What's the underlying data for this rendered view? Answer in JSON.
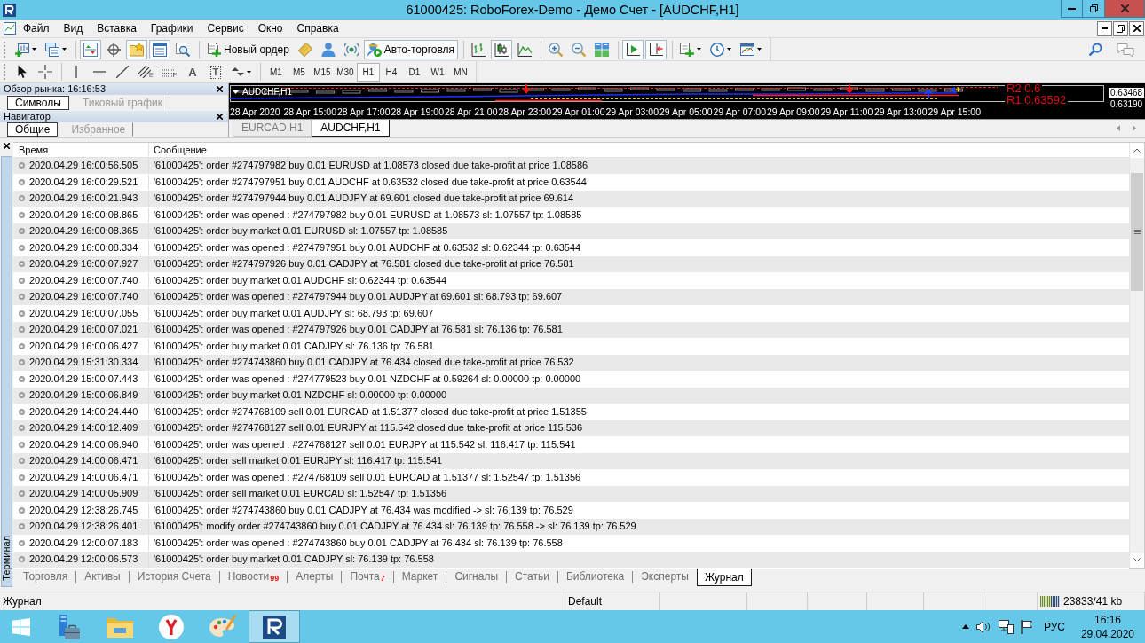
{
  "window": {
    "title": "61000425: RoboForex-Demo - Демо Счет - [AUDCHF,H1]"
  },
  "menu": [
    "Файл",
    "Вид",
    "Вставка",
    "Графики",
    "Сервис",
    "Окно",
    "Справка"
  ],
  "toolbar": {
    "groups": [
      [
        {
          "kind": "chart",
          "pressed": false
        },
        {
          "kind": "profiles",
          "pressed": false
        }
      ],
      [
        {
          "kind": "market",
          "pressed": true
        },
        {
          "kind": "navigator",
          "pressed": false
        },
        {
          "kind": "favorites",
          "pressed": true
        },
        {
          "kind": "data",
          "pressed": true
        },
        {
          "kind": "tester",
          "pressed": false
        }
      ],
      [
        {
          "kind": "order",
          "label": "Новый ордер",
          "pressed": false
        },
        {
          "kind": "editor",
          "pressed": false
        },
        {
          "kind": "vps",
          "pressed": false
        },
        {
          "kind": "signals",
          "pressed": false
        },
        {
          "kind": "autotrading",
          "label": "Авто-торговля",
          "pressed": true
        }
      ],
      [
        {
          "kind": "bars",
          "pressed": false
        },
        {
          "kind": "candles",
          "pressed": true
        },
        {
          "kind": "line",
          "pressed": false
        }
      ],
      [
        {
          "kind": "zoomin",
          "pressed": false
        },
        {
          "kind": "zoomout",
          "pressed": false
        },
        {
          "kind": "tile",
          "pressed": false
        }
      ],
      [
        {
          "kind": "autoscroll",
          "pressed": true
        },
        {
          "kind": "shift",
          "pressed": true
        }
      ],
      [
        {
          "kind": "indicators",
          "pressed": false
        },
        {
          "kind": "periods",
          "pressed": false
        },
        {
          "kind": "templates",
          "pressed": false
        }
      ]
    ]
  },
  "drawing_tools": [
    [
      {
        "kind": "cursor"
      },
      {
        "kind": "crosshair"
      }
    ],
    [
      {
        "kind": "vline"
      },
      {
        "kind": "hline"
      },
      {
        "kind": "trend"
      },
      {
        "kind": "channel",
        "glyph": "E"
      },
      {
        "kind": "fibo",
        "glyph": "F"
      },
      {
        "kind": "text",
        "glyph": "A"
      },
      {
        "kind": "label",
        "glyph": "T"
      },
      {
        "kind": "arrows"
      }
    ]
  ],
  "timeframes": [
    {
      "label": "M1",
      "selected": false
    },
    {
      "label": "M5",
      "selected": false
    },
    {
      "label": "M15",
      "selected": false
    },
    {
      "label": "M30",
      "selected": false
    },
    {
      "label": "H1",
      "selected": true
    },
    {
      "label": "H4",
      "selected": false
    },
    {
      "label": "D1",
      "selected": false
    },
    {
      "label": "W1",
      "selected": false
    },
    {
      "label": "MN",
      "selected": false
    }
  ],
  "market_watch": {
    "title": "Обзор рынка: 16:16:53",
    "tabs": [
      {
        "label": "Символы",
        "selected": true
      },
      {
        "label": "Тиковый график",
        "selected": false
      }
    ]
  },
  "navigator": {
    "title": "Навигатор",
    "tabs": [
      {
        "label": "Общие",
        "selected": true
      },
      {
        "label": "Избранное",
        "selected": false
      }
    ]
  },
  "chart": {
    "symbol": "AUDCHF,H1",
    "levels": [
      "R2 0.6",
      "R1 0.63592"
    ],
    "prices": [
      "0.63468",
      "0.63190"
    ],
    "time_labels": [
      "28 Apr 2020",
      "28 Apr 15:00",
      "28 Apr 17:00",
      "28 Apr 19:00",
      "28 Apr 21:00",
      "28 Apr 23:00",
      "29 Apr 01:00",
      "29 Apr 03:00",
      "29 Apr 05:00",
      "29 Apr 07:00",
      "29 Apr 09:00",
      "29 Apr 11:00",
      "29 Apr 13:00",
      "29 Apr 15:00"
    ]
  },
  "chart_tabs": [
    {
      "label": "EURCAD,H1",
      "selected": false
    },
    {
      "label": "AUDCHF,H1",
      "selected": true
    }
  ],
  "terminal": {
    "title": "Терминал",
    "columns": [
      "Время",
      "Сообщение"
    ],
    "rows": [
      {
        "time": "2020.04.29 16:00:56.505",
        "message": "'61000425': order #274797982 buy 0.01 EURUSD at 1.08573 closed due take-profit at price 1.08586"
      },
      {
        "time": "2020.04.29 16:00:29.521",
        "message": "'61000425': order #274797951 buy 0.01 AUDCHF at 0.63532 closed due take-profit at price 0.63544"
      },
      {
        "time": "2020.04.29 16:00:21.943",
        "message": "'61000425': order #274797944 buy 0.01 AUDJPY at 69.601 closed due take-profit at price 69.614"
      },
      {
        "time": "2020.04.29 16:00:08.865",
        "message": "'61000425': order was opened : #274797982 buy 0.01 EURUSD at 1.08573 sl: 1.07557 tp: 1.08585"
      },
      {
        "time": "2020.04.29 16:00:08.365",
        "message": "'61000425': order buy market 0.01 EURUSD sl: 1.07557 tp: 1.08585"
      },
      {
        "time": "2020.04.29 16:00:08.334",
        "message": "'61000425': order was opened : #274797951 buy 0.01 AUDCHF at 0.63532 sl: 0.62344 tp: 0.63544"
      },
      {
        "time": "2020.04.29 16:00:07.927",
        "message": "'61000425': order #274797926 buy 0.01 CADJPY at 76.581 closed due take-profit at price 76.581"
      },
      {
        "time": "2020.04.29 16:00:07.740",
        "message": "'61000425': order buy market 0.01 AUDCHF sl: 0.62344 tp: 0.63544"
      },
      {
        "time": "2020.04.29 16:00:07.740",
        "message": "'61000425': order was opened : #274797944 buy 0.01 AUDJPY at 69.601 sl: 68.793 tp: 69.607"
      },
      {
        "time": "2020.04.29 16:00:07.055",
        "message": "'61000425': order buy market 0.01 AUDJPY sl: 68.793 tp: 69.607"
      },
      {
        "time": "2020.04.29 16:00:07.021",
        "message": "'61000425': order was opened : #274797926 buy 0.01 CADJPY at 76.581 sl: 76.136 tp: 76.581"
      },
      {
        "time": "2020.04.29 16:00:06.427",
        "message": "'61000425': order buy market 0.01 CADJPY sl: 76.136 tp: 76.581"
      },
      {
        "time": "2020.04.29 15:31:30.334",
        "message": "'61000425': order #274743860 buy 0.01 CADJPY at 76.434 closed due take-profit at price 76.532"
      },
      {
        "time": "2020.04.29 15:00:07.443",
        "message": "'61000425': order was opened : #274779523 buy 0.01 NZDCHF at 0.59264 sl: 0.00000 tp: 0.00000"
      },
      {
        "time": "2020.04.29 15:00:06.849",
        "message": "'61000425': order buy market 0.01 NZDCHF sl: 0.00000 tp: 0.00000"
      },
      {
        "time": "2020.04.29 14:00:24.440",
        "message": "'61000425': order #274768109 sell 0.01 EURCAD at 1.51377 closed due take-profit at price 1.51355"
      },
      {
        "time": "2020.04.29 14:00:12.409",
        "message": "'61000425': order #274768127 sell 0.01 EURJPY at 115.542 closed due take-profit at price 115.536"
      },
      {
        "time": "2020.04.29 14:00:06.940",
        "message": "'61000425': order was opened : #274768127 sell 0.01 EURJPY at 115.542 sl: 116.417 tp: 115.541"
      },
      {
        "time": "2020.04.29 14:00:06.471",
        "message": "'61000425': order sell market 0.01 EURJPY sl: 116.417 tp: 115.541"
      },
      {
        "time": "2020.04.29 14:00:06.471",
        "message": "'61000425': order was opened : #274768109 sell 0.01 EURCAD at 1.51377 sl: 1.52547 tp: 1.51356"
      },
      {
        "time": "2020.04.29 14:00:05.909",
        "message": "'61000425': order sell market 0.01 EURCAD sl: 1.52547 tp: 1.51356"
      },
      {
        "time": "2020.04.29 12:38:26.745",
        "message": "'61000425': order #274743860 buy 0.01 CADJPY at 76.434 was modified -> sl: 76.139 tp: 76.529"
      },
      {
        "time": "2020.04.29 12:38:26.401",
        "message": "'61000425': modify order #274743860 buy 0.01 CADJPY at 76.434 sl: 76.139 tp: 76.558 -> sl: 76.139 tp: 76.529"
      },
      {
        "time": "2020.04.29 12:00:07.183",
        "message": "'61000425': order was opened : #274743860 buy 0.01 CADJPY at 76.434 sl: 76.139 tp: 76.558"
      },
      {
        "time": "2020.04.29 12:00:06.573",
        "message": "'61000425': order buy market 0.01 CADJPY sl: 76.139 tp: 76.558"
      }
    ],
    "tabs": [
      {
        "label": "Торговля",
        "selected": false
      },
      {
        "label": "Активы",
        "selected": false
      },
      {
        "label": "История Счета",
        "selected": false
      },
      {
        "label": "Новости",
        "badge": "99",
        "selected": false
      },
      {
        "label": "Алерты",
        "selected": false
      },
      {
        "label": "Почта",
        "badge": "7",
        "selected": false
      },
      {
        "label": "Маркет",
        "selected": false
      },
      {
        "label": "Сигналы",
        "selected": false
      },
      {
        "label": "Статьи",
        "selected": false
      },
      {
        "label": "Библиотека",
        "selected": false
      },
      {
        "label": "Эксперты",
        "selected": false
      },
      {
        "label": "Журнал",
        "selected": true
      }
    ]
  },
  "status_bar": {
    "mode": "Журнал",
    "profile": "Default",
    "traffic": "23833/41 kb"
  },
  "taskbar": {
    "apps": [
      {
        "kind": "start",
        "active": false
      },
      {
        "kind": "server",
        "active": false
      },
      {
        "kind": "explorer",
        "active": false
      },
      {
        "kind": "browser",
        "active": false
      },
      {
        "kind": "paint",
        "active": false
      },
      {
        "kind": "terminal",
        "active": true
      }
    ],
    "language": "РУС",
    "time": "16:16",
    "date": "29.04.2020"
  }
}
